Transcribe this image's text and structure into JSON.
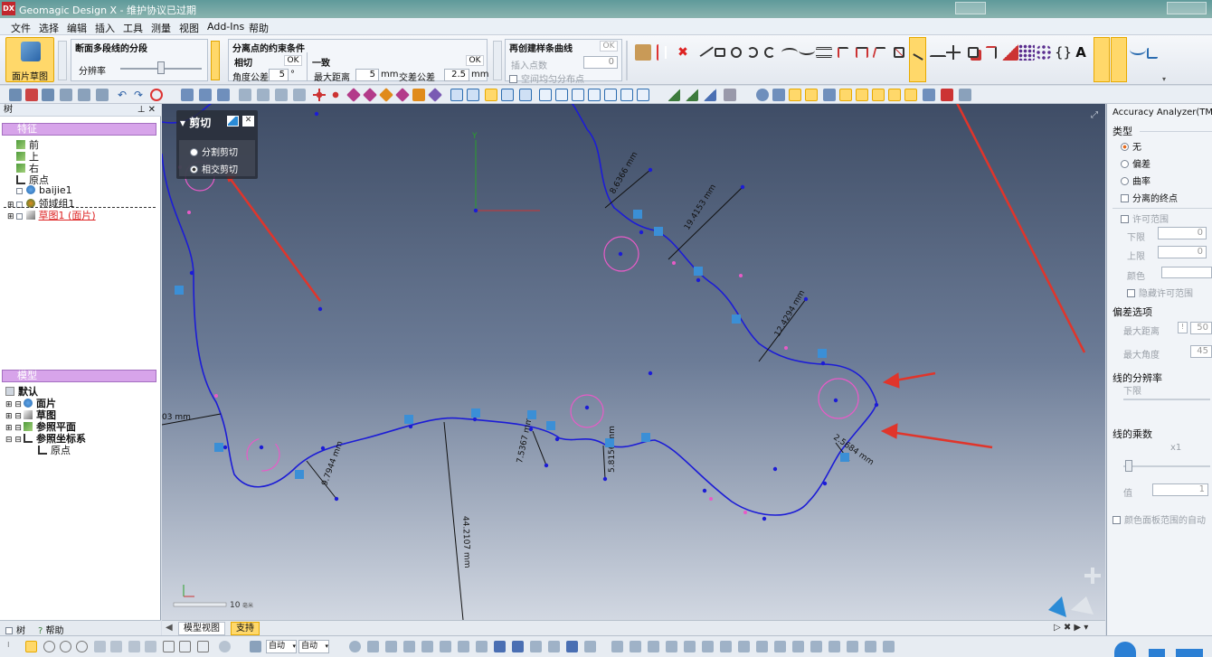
{
  "window": {
    "title": "Geomagic Design X - 维护协议已过期",
    "logo": "DX"
  },
  "menu": [
    "文件",
    "选择",
    "编辑",
    "插入",
    "工具",
    "测量",
    "视图",
    "Add-Ins",
    "帮助"
  ],
  "ribbon": {
    "mesh_sketch_label": "面片草图",
    "segment": {
      "title": "断面多段线的分段",
      "resolution_label": "分辨率"
    },
    "constraints": {
      "title": "分离点的约束条件",
      "tangent": {
        "label": "相切",
        "ok": "OK",
        "angle_tol_label": "角度公差",
        "angle_tol_value": "5",
        "angle_unit": "°"
      },
      "consistent": {
        "label": "一致",
        "ok": "OK",
        "max_dist_label": "最大距离",
        "max_dist_value": "5",
        "max_dist_unit": "mm",
        "cross_tol_label": "交差公差",
        "cross_tol_value": "2.5",
        "cross_tol_unit": "mm"
      }
    },
    "rebuild": {
      "title": "再创建样条曲线",
      "ok": "OK",
      "insert_points_label": "插入点数",
      "insert_points_value": "0",
      "spatial_label": "空间均匀分布点"
    }
  },
  "tree": {
    "panel_title": "树",
    "features_header": "特征",
    "features": [
      "前",
      "上",
      "右",
      "原点",
      "baijie1",
      "领域组1",
      "草图1 (面片)"
    ],
    "model_header": "模型",
    "model": [
      "默认",
      "面片",
      "草图",
      "参照平面",
      "参照坐标系",
      "原点"
    ]
  },
  "cut_panel": {
    "title": "剪切",
    "options": [
      "分割剪切",
      "相交剪切"
    ],
    "selected": 1
  },
  "viewport": {
    "dimensions": [
      "8.6366 mm",
      "19.4153 mm",
      "12.4294 mm",
      "2.5684 mm",
      "7.5367 mm",
      "5.8156 mm",
      "9.7944 mm",
      "44.2107 mm",
      "03 mm"
    ],
    "scale_label": "10",
    "scale_unit": "毫米",
    "axis_y": "Y"
  },
  "right_panel": {
    "title": "Accuracy Analyzer(TM)",
    "type_label": "类型",
    "type_options": [
      "无",
      "偏差",
      "曲率"
    ],
    "type_selected": 0,
    "separated_endpoints": "分离的终点",
    "tolerance_range": "许可范围",
    "lower_label": "下限",
    "lower_value": "0",
    "upper_label": "上限",
    "upper_value": "0",
    "color_label": "颜色",
    "hide_range": "隐藏许可范围",
    "deviation_options": "偏差选项",
    "max_dist_label": "最大距离",
    "max_dist_value": "50",
    "max_angle_label": "最大角度",
    "max_angle_value": "45",
    "line_resolution": "线的分辨率",
    "line_res_lower": "下限",
    "line_factor": "线的乘数",
    "line_factor_scale": "x1",
    "value_label": "值",
    "value": "1",
    "color_panel_auto": "颜色面板范围的自动"
  },
  "bottom": {
    "left_tabs": [
      "树",
      "帮助"
    ],
    "view_tabs": [
      "模型视图",
      "支持"
    ],
    "status_select1": "自动",
    "status_select2": "自动"
  }
}
